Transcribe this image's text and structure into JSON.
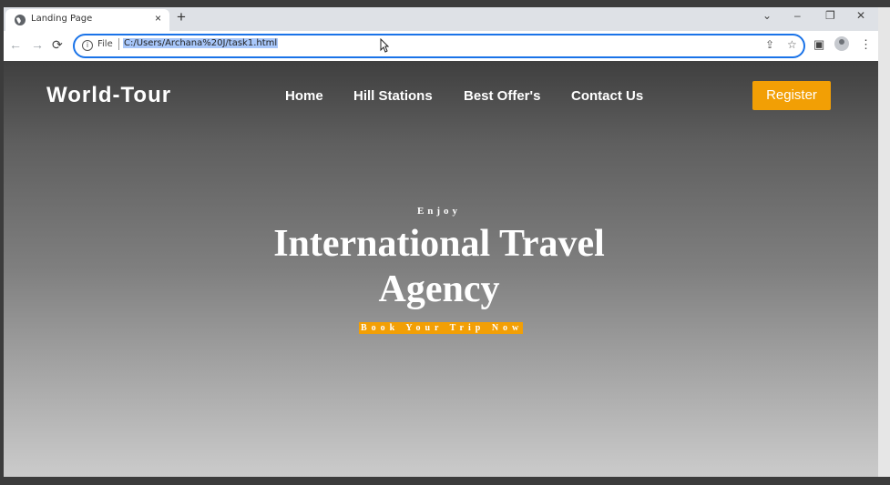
{
  "browser": {
    "tab_title": "Landing Page",
    "tab_close": "×",
    "new_tab": "+",
    "window_controls": {
      "dropdown": "⌄",
      "minimize": "–",
      "restore": "❐",
      "close": "✕"
    },
    "nav": {
      "back": "←",
      "forward": "→",
      "reload": "⟳"
    },
    "info_icon": "i",
    "scheme_label": "File",
    "url": "C:/Users/Archana%20J/task1.html",
    "omnibox_icons": {
      "share": "⇪",
      "bookmark": "☆"
    },
    "toolbar_icons": {
      "side_panel": "▣",
      "menu": "⋮"
    }
  },
  "site": {
    "logo": "World-Tour",
    "nav_links": [
      "Home",
      "Hill Stations",
      "Best Offer's",
      "Contact Us"
    ],
    "register_label": "Register",
    "accent_color": "#f29f05"
  },
  "hero": {
    "eyebrow": "Enjoy",
    "title": "International Travel Agency",
    "cta": "Book Your Trip Now"
  }
}
